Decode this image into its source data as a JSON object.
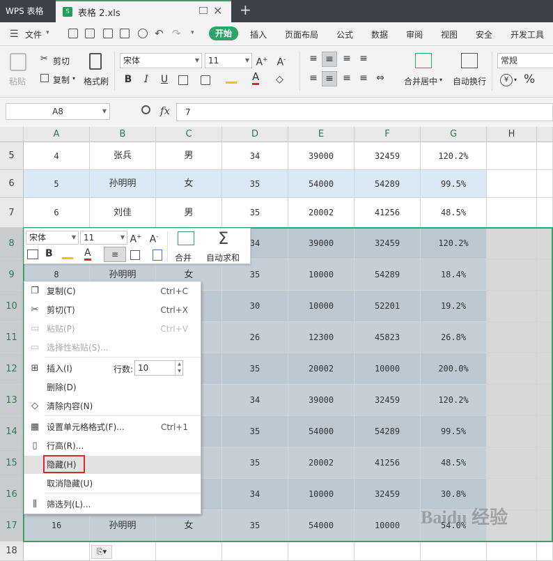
{
  "app": {
    "title": "WPS 表格",
    "file_tab": "表格 2.xls",
    "new_tab_symbol": "+"
  },
  "menu": {
    "file": "文件",
    "tabs": [
      "开始",
      "插入",
      "页面布局",
      "公式",
      "数据",
      "审阅",
      "视图",
      "安全",
      "开发工具"
    ],
    "active_tab": "开始"
  },
  "toolbar": {
    "paste": "粘贴",
    "cut": "剪切",
    "copy": "复制",
    "format_painter": "格式刷",
    "font_name": "宋体",
    "font_size": "11",
    "bold": "B",
    "italic": "I",
    "underline": "U",
    "merge_center": "合并居中",
    "wrap_text": "自动换行",
    "number_format": "常规",
    "percent": "%",
    "currency": "¥"
  },
  "formula_bar": {
    "name_box": "A8",
    "fx": "fx",
    "value": "7"
  },
  "grid": {
    "columns": [
      "A",
      "B",
      "C",
      "D",
      "E",
      "F",
      "G",
      "H"
    ],
    "rows": [
      {
        "n": "5",
        "a": "4",
        "b": "张兵",
        "c": "男",
        "d": "34",
        "e": "39000",
        "f": "32459",
        "g": "120.2%"
      },
      {
        "n": "6",
        "a": "5",
        "b": "孙明明",
        "c": "女",
        "d": "35",
        "e": "54000",
        "f": "54289",
        "g": "99.5%"
      },
      {
        "n": "7",
        "a": "6",
        "b": "刘佳",
        "c": "男",
        "d": "35",
        "e": "20002",
        "f": "41256",
        "g": "48.5%"
      },
      {
        "n": "8",
        "a": "",
        "b": "",
        "c": "",
        "d": "34",
        "e": "39000",
        "f": "32459",
        "g": "120.2%"
      },
      {
        "n": "9",
        "a": "8",
        "b": "孙明明",
        "c": "女",
        "d": "35",
        "e": "10000",
        "f": "54289",
        "g": "18.4%"
      },
      {
        "n": "10",
        "a": "",
        "b": "",
        "c": "",
        "d": "30",
        "e": "10000",
        "f": "52201",
        "g": "19.2%"
      },
      {
        "n": "11",
        "a": "",
        "b": "",
        "c": "",
        "d": "26",
        "e": "12300",
        "f": "45823",
        "g": "26.8%"
      },
      {
        "n": "12",
        "a": "",
        "b": "",
        "c": "",
        "d": "35",
        "e": "20002",
        "f": "10000",
        "g": "200.0%"
      },
      {
        "n": "13",
        "a": "",
        "b": "",
        "c": "",
        "d": "34",
        "e": "39000",
        "f": "32459",
        "g": "120.2%"
      },
      {
        "n": "14",
        "a": "",
        "b": "",
        "c": "",
        "d": "35",
        "e": "54000",
        "f": "54289",
        "g": "99.5%"
      },
      {
        "n": "15",
        "a": "",
        "b": "",
        "c": "",
        "d": "35",
        "e": "20002",
        "f": "41256",
        "g": "48.5%"
      },
      {
        "n": "16",
        "a": "",
        "b": "",
        "c": "",
        "d": "34",
        "e": "10000",
        "f": "32459",
        "g": "30.8%"
      },
      {
        "n": "17",
        "a": "16",
        "b": "孙明明",
        "c": "女",
        "d": "35",
        "e": "54000",
        "f": "10000",
        "g": "54.0%"
      },
      {
        "n": "18",
        "a": "",
        "b": "",
        "c": "",
        "d": "",
        "e": "",
        "f": "",
        "g": ""
      }
    ]
  },
  "mini_toolbar": {
    "font_name": "宋体",
    "font_size": "11",
    "merge": "合并",
    "autosum": "自动求和"
  },
  "context_menu": {
    "items": [
      {
        "label": "复制(C)",
        "shortcut": "Ctrl+C",
        "icon": "copy-icon",
        "disabled": false
      },
      {
        "label": "剪切(T)",
        "shortcut": "Ctrl+X",
        "icon": "scissors-icon",
        "disabled": false
      },
      {
        "label": "粘贴(P)",
        "shortcut": "Ctrl+V",
        "icon": "paste-icon",
        "disabled": true
      },
      {
        "label": "选择性粘贴(S)...",
        "shortcut": "",
        "icon": "paste-special-icon",
        "disabled": true
      },
      {
        "label": "插入(I)",
        "shortcut": "",
        "icon": "insert-row-icon",
        "disabled": false
      },
      {
        "label": "删除(D)",
        "shortcut": "",
        "icon": "",
        "disabled": false
      },
      {
        "label": "清除内容(N)",
        "shortcut": "",
        "icon": "eraser-icon",
        "disabled": false
      },
      {
        "label": "设置单元格格式(F)...",
        "shortcut": "Ctrl+1",
        "icon": "format-cells-icon",
        "disabled": false
      },
      {
        "label": "行高(R)...",
        "shortcut": "",
        "icon": "row-height-icon",
        "disabled": false
      },
      {
        "label": "隐藏(H)",
        "shortcut": "",
        "icon": "",
        "disabled": false
      },
      {
        "label": "取消隐藏(U)",
        "shortcut": "",
        "icon": "",
        "disabled": false
      },
      {
        "label": "筛选列(L)...",
        "shortcut": "",
        "icon": "filter-columns-icon",
        "disabled": false
      }
    ],
    "rows_label": "行数:",
    "rows_value": "10"
  },
  "watermark": "Baidu 经验"
}
